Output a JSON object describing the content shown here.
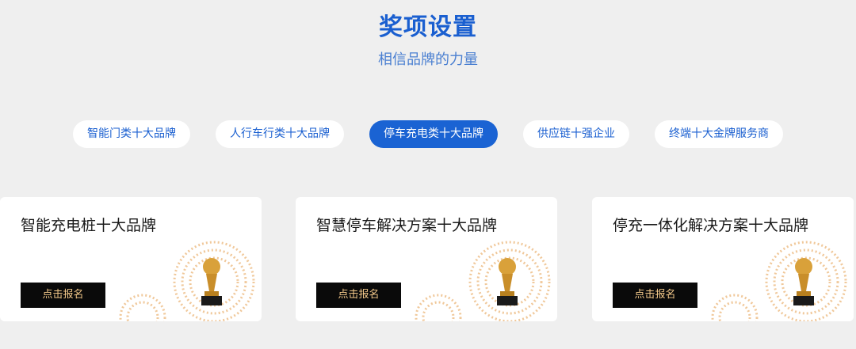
{
  "header": {
    "title": "奖项设置",
    "subtitle": "相信品牌的力量"
  },
  "tabs": [
    {
      "label": "智能门类十大品牌",
      "active": false
    },
    {
      "label": "人行车行类十大品牌",
      "active": false
    },
    {
      "label": "停车充电类十大品牌",
      "active": true
    },
    {
      "label": "供应链十强企业",
      "active": false
    },
    {
      "label": "终端十大金牌服务商",
      "active": false
    }
  ],
  "cards": [
    {
      "title": "智能充电桩十大品牌",
      "button_label": "点击报名",
      "icon": "trophy-icon"
    },
    {
      "title": "智慧停车解决方案十大品牌",
      "button_label": "点击报名",
      "icon": "trophy-icon"
    },
    {
      "title": "停充一体化解决方案十大品牌",
      "button_label": "点击报名",
      "icon": "trophy-icon"
    }
  ],
  "colors": {
    "accent": "#1a63d3",
    "background": "#efefef",
    "button_bg": "#0a0a0a",
    "button_text": "#f4c98a",
    "trophy_gold": "#d9a13a"
  }
}
